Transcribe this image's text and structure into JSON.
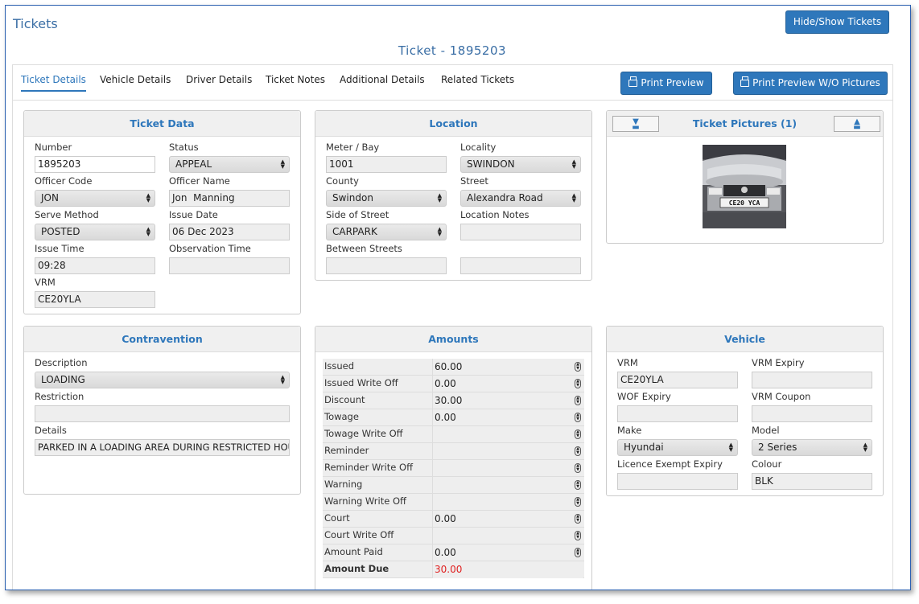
{
  "app_title": "Tickets",
  "hide_show_label": "Hide/Show Tickets",
  "ticket_heading": "Ticket - 1895203",
  "tabs": [
    "Ticket Details",
    "Vehicle Details",
    "Driver Details",
    "Ticket Notes",
    "Additional Details",
    "Related Tickets"
  ],
  "print_preview_label": "Print Preview",
  "print_preview_wo_label": "Print Preview W/O Pictures",
  "ticket_data": {
    "title": "Ticket Data",
    "number_label": "Number",
    "number": "1895203",
    "status_label": "Status",
    "status": "APPEAL",
    "officer_code_label": "Officer Code",
    "officer_code": "JON",
    "officer_name_label": "Officer Name",
    "officer_name": "Jon  Manning",
    "serve_method_label": "Serve Method",
    "serve_method": "POSTED",
    "issue_date_label": "Issue Date",
    "issue_date": "06 Dec 2023",
    "issue_time_label": "Issue Time",
    "issue_time": "09:28",
    "observation_time_label": "Observation Time",
    "observation_time": "",
    "vrm_label": "VRM",
    "vrm": "CE20YLA"
  },
  "location": {
    "title": "Location",
    "meter_label": "Meter / Bay",
    "meter": "1001",
    "locality_label": "Locality",
    "locality": "SWINDON",
    "county_label": "County",
    "county": "Swindon",
    "street_label": "Street",
    "street": "Alexandra Road",
    "side_label": "Side of Street",
    "side": "CARPARK",
    "notes_label": "Location Notes",
    "notes": "",
    "between_label": "Between Streets"
  },
  "pictures": {
    "title": "Ticket Pictures (1)",
    "plate_text": "CE20 YCA"
  },
  "contravention": {
    "title": "Contravention",
    "description_label": "Description",
    "description": "LOADING",
    "restriction_label": "Restriction",
    "restriction": "",
    "details_label": "Details",
    "details": "PARKED IN A LOADING AREA DURING RESTRICTED HOU"
  },
  "amounts": {
    "title": "Amounts",
    "rows": [
      {
        "label": "Issued",
        "value": "60.00"
      },
      {
        "label": "Issued Write Off",
        "value": "0.00"
      },
      {
        "label": "Discount",
        "value": "30.00"
      },
      {
        "label": "Towage",
        "value": "0.00"
      },
      {
        "label": "Towage Write Off",
        "value": ""
      },
      {
        "label": "Reminder",
        "value": ""
      },
      {
        "label": "Reminder Write Off",
        "value": ""
      },
      {
        "label": "Warning",
        "value": ""
      },
      {
        "label": "Warning Write Off",
        "value": ""
      },
      {
        "label": "Court",
        "value": "0.00"
      },
      {
        "label": "Court Write Off",
        "value": ""
      },
      {
        "label": "Amount Paid",
        "value": "0.00"
      }
    ],
    "due_label": "Amount Due",
    "due_value": "30.00"
  },
  "vehicle": {
    "title": "Vehicle",
    "vrm_label": "VRM",
    "vrm": "CE20YLA",
    "vrm_expiry_label": "VRM Expiry",
    "vrm_expiry": "",
    "wof_label": "WOF Expiry",
    "wof": "",
    "coupon_label": "VRM Coupon",
    "coupon": "",
    "make_label": "Make",
    "make": "Hyundai",
    "model_label": "Model",
    "model": "2 Series",
    "licence_label": "Licence Exempt Expiry",
    "licence": "",
    "colour_label": "Colour",
    "colour": "BLK"
  },
  "colors": {
    "accent": "#2e77bb",
    "due": "#e02020"
  }
}
